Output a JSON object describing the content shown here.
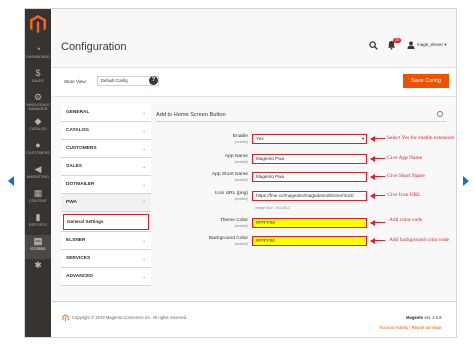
{
  "colors": {
    "accent": "#eb5202",
    "sidebar": "#373330",
    "annotation": "#e31e24",
    "highlight": "#ffff00"
  },
  "sidebar": {
    "items": [
      {
        "label": "Dashboard",
        "icon": "dashboard-icon",
        "glyph": "◔"
      },
      {
        "label": "Sales",
        "icon": "dollar-icon",
        "glyph": "$"
      },
      {
        "label": "Wholesale Manager",
        "icon": "gear-icon",
        "glyph": "⚙"
      },
      {
        "label": "Catalog",
        "icon": "cube-icon",
        "glyph": "◆"
      },
      {
        "label": "Customers",
        "icon": "person-icon",
        "glyph": "●"
      },
      {
        "label": "Marketing",
        "icon": "megaphone-icon",
        "glyph": "◀"
      },
      {
        "label": "Content",
        "icon": "layout-icon",
        "glyph": "▦"
      },
      {
        "label": "Reports",
        "icon": "bar-chart-icon",
        "glyph": "▮"
      },
      {
        "label": "Stores",
        "icon": "store-icon",
        "glyph": "▤"
      },
      {
        "label": "",
        "icon": "extensions-icon",
        "glyph": "✱"
      }
    ]
  },
  "header": {
    "title": "Configuration",
    "notifications_count": "25",
    "user": "mage_elsner ▾"
  },
  "store_view": {
    "label": "Store View:",
    "value": "Default Config"
  },
  "save_label": "Save Config",
  "tabs": [
    {
      "label": "GENERAL"
    },
    {
      "label": "CATALOG"
    },
    {
      "label": "CUSTOMERS"
    },
    {
      "label": "SALES"
    },
    {
      "label": "DOTMAILER"
    },
    {
      "label": "PWA"
    },
    {
      "label": "ELSNER"
    },
    {
      "label": "SERVICES"
    },
    {
      "label": "ADVANCED"
    }
  ],
  "sub_tab": "General Settings",
  "section_title": "Add to Home Screen Button",
  "fields": {
    "enable": {
      "label": "Enable",
      "scope": "[website]",
      "value": "Yes"
    },
    "app_name": {
      "label": "App Name",
      "scope": "[website]",
      "value": "Magento Pwa"
    },
    "app_short_name": {
      "label": "App Short Name",
      "scope": "[website]",
      "value": "Magento Pwa"
    },
    "icon_url": {
      "label": "Icon URL (png)",
      "scope": "[website]",
      "value": "https://fme.co/magedev/magedemo/Elsner/m22/",
      "note": "Image Size : 512x512"
    },
    "theme_color": {
      "label": "Theme Color",
      "scope": "[website]",
      "value": "#FFFF00"
    },
    "background_color": {
      "label": "Background Color",
      "scope": "[website]",
      "value": "#FFFF00"
    }
  },
  "annotations": {
    "enable": "Select Yes for enable extension",
    "app_name": "Give App Name",
    "app_short_name": "Give Short Name",
    "icon_url": "Give Icon URL",
    "theme_color": "Add color code",
    "background_color": "Add background color code"
  },
  "footer": {
    "copyright": "Copyright © 2019 Magento Commerce Inc. All rights reserved.",
    "product": "Magento",
    "version": " ver. 2.2.6",
    "activity": "Account Activity",
    "separator": "|",
    "report": "Report an Issue"
  }
}
